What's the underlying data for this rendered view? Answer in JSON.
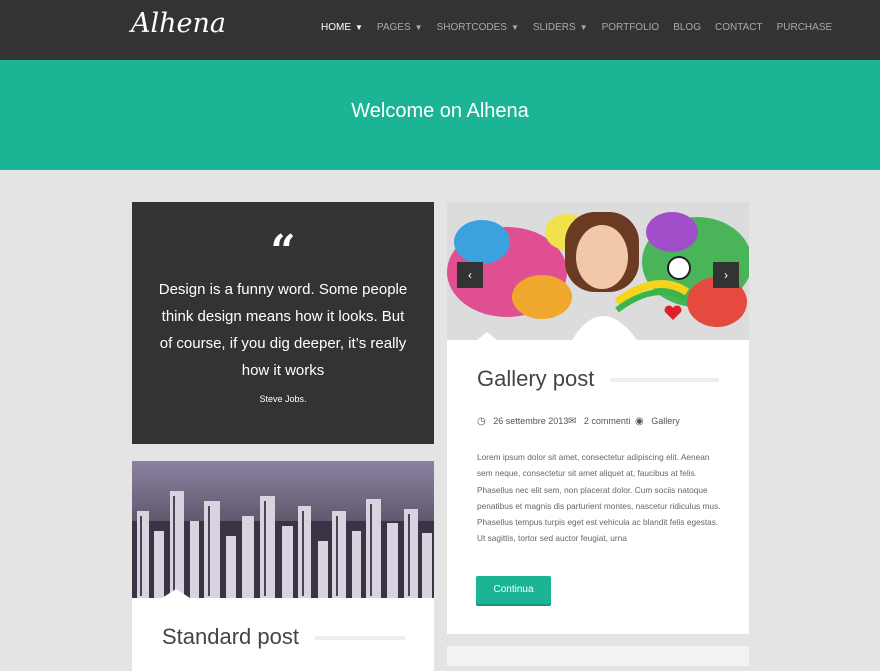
{
  "header": {
    "logo": "Alhena",
    "nav": [
      {
        "label": "HOME",
        "dropdown": true,
        "active": true
      },
      {
        "label": "PAGES",
        "dropdown": true
      },
      {
        "label": "SHORTCODES",
        "dropdown": true
      },
      {
        "label": "SLIDERS",
        "dropdown": true
      },
      {
        "label": "PORTFOLIO",
        "dropdown": false
      },
      {
        "label": "BLOG",
        "dropdown": false
      },
      {
        "label": "CONTACT",
        "dropdown": false
      },
      {
        "label": "PURCHASE",
        "dropdown": false
      }
    ]
  },
  "hero": {
    "title": "Welcome on Alhena"
  },
  "quote": {
    "icon": "quote-icon",
    "text": "Design is a funny word. Some people think design means how it looks. But of course, if you dig deeper, it’s really how it works",
    "author": "Steve Jobs."
  },
  "standard_post": {
    "title": "Standard post"
  },
  "gallery_post": {
    "title": "Gallery post",
    "date": "26 settembre 2013",
    "comments": "2 commenti",
    "category": "Gallery",
    "excerpt": "Lorem ipsum dolor sit amet, consectetur adipiscing elit. Aenean sem neque, consectetur sit amet aliquet at, faucibus at felis. Phasellus nec elit sem, non placerat dolor. Cum sociis natoque penatibus et magnis dis parturient montes, nascetur ridiculus mus. Phasellus tempus turpis eget est vehicula ac blandit felis egestas. Ut sagittis, tortor sed auctor feugiat, urna",
    "button": "Continua",
    "prev_icon": "chevron-left-icon",
    "next_icon": "chevron-right-icon"
  },
  "colors": {
    "accent": "#1bb495",
    "dark": "#333333",
    "background": "#e4e4e4"
  }
}
